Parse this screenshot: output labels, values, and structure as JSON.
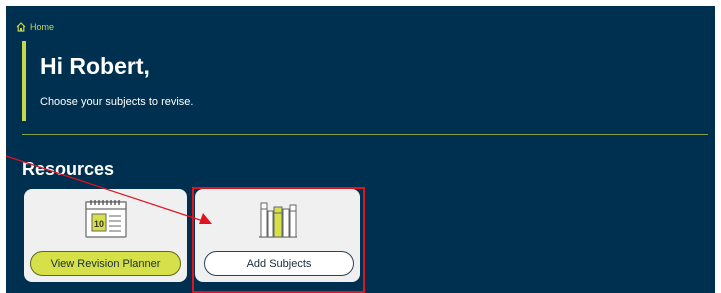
{
  "breadcrumb": {
    "home_label": "Home",
    "icon": "home-icon"
  },
  "greeting": {
    "title": "Hi Robert,",
    "subtitle": "Choose your subjects to revise."
  },
  "resources": {
    "title": "Resources",
    "cards": [
      {
        "icon": "calendar-icon",
        "button_label": "View Revision Planner"
      },
      {
        "icon": "books-icon",
        "button_label": "Add Subjects"
      }
    ]
  },
  "colors": {
    "background": "#00304f",
    "accent": "#c8d64b",
    "annotation": "#e0141e",
    "card": "#f0f0f0"
  }
}
